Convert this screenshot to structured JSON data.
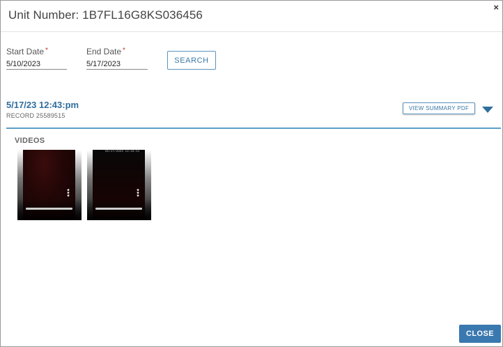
{
  "dialog": {
    "title": "Unit Number: 1B7FL16G8KS036456",
    "close_icon": "×"
  },
  "filters": {
    "start_date": {
      "label": "Start Date",
      "value": "5/10/2023",
      "required": "*"
    },
    "end_date": {
      "label": "End Date",
      "value": "5/17/2023",
      "required": "*"
    },
    "search_label": "SEARCH"
  },
  "record": {
    "datetime": "5/17/23 12:43:pm",
    "record_label": "RECORD 25589515",
    "view_pdf_label": "VIEW SUMMARY PDF",
    "expand_icon": "caret-down-icon"
  },
  "videos": {
    "heading": "VIDEOS",
    "items": [
      {
        "name": "video-1",
        "timestamp": ""
      },
      {
        "name": "video-2",
        "timestamp": "05/17/2023 12:43:51"
      }
    ]
  },
  "footer": {
    "close_label": "CLOSE"
  },
  "colors": {
    "accent": "#3a78b0",
    "link": "#2f6e9e",
    "divider": "#5a9ec6",
    "required": "#c0392b"
  }
}
